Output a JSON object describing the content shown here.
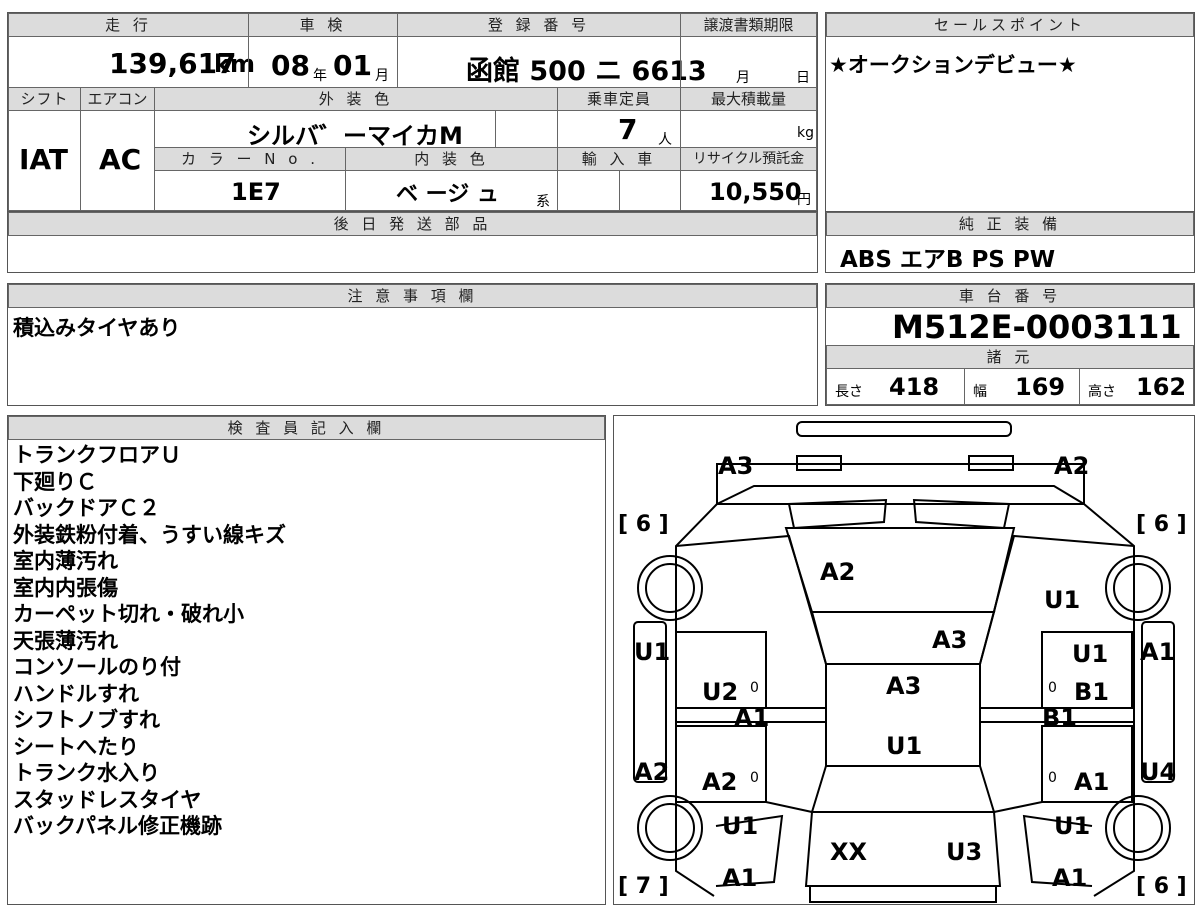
{
  "header": {
    "mileage_label": "走 行",
    "inspection_label": "車 検",
    "registration_label": "登 録 番 号",
    "transfer_label": "譲渡書類期限",
    "sales_label": "セールスポイント"
  },
  "vehicle": {
    "mileage_value": "139,617",
    "mileage_unit": "km",
    "inspection_year": "08",
    "inspection_year_unit": "年",
    "inspection_month": "01",
    "inspection_month_unit": "月",
    "registration_number": "函館 500 ニ 6613",
    "transfer_month_unit": "月",
    "transfer_day_unit": "日",
    "shift_label": "シフト",
    "shift_value": "IAT",
    "ac_label": "エアコン",
    "ac_value": "AC",
    "exterior_color_label": "外 装 色",
    "exterior_color_value": "シルバ゛ーマイカM",
    "color_no_label": "カ ラ ー N o .",
    "color_no_value": "1E7",
    "interior_color_label": "内 装 色",
    "interior_color_value": "ベ ージ ュ",
    "interior_color_suffix": "系",
    "capacity_label": "乗車定員",
    "capacity_value": "7",
    "capacity_unit": "人",
    "max_load_label": "最大積載量",
    "max_load_unit": "kg",
    "import_label": "輸 入 車",
    "recycle_label": "リサイクル預託金",
    "recycle_value": "10,550",
    "recycle_unit": "円"
  },
  "sales_point": "★オークションデビュー★",
  "later_parts_label": "後 日 発 送 部 品",
  "genuine_equipment": {
    "label": "純 正 装 備",
    "value": "ABS エアB PS PW"
  },
  "notes": {
    "label": "注 意 事 項 欄",
    "value": "積込みタイヤあり"
  },
  "chassis": {
    "label": "車 台 番 号",
    "value": "M512E-0003111",
    "specs_label": "諸 元",
    "length_label": "長さ",
    "length_value": "418",
    "width_label": "幅",
    "width_value": "169",
    "height_label": "高さ",
    "height_value": "162"
  },
  "inspector": {
    "label": "検 査 員 記 入 欄",
    "lines": [
      "トランクフロアＵ",
      "下廻りＣ",
      "バックドアＣ２",
      "外装鉄粉付着、うすい線キズ",
      "室内薄汚れ",
      "室内内張傷",
      "カーペット切れ・破れ小",
      "天張薄汚れ",
      "コンソールのり付",
      "ハンドルすれ",
      "シフトノブすれ",
      "シートへたり",
      "トランク水入り",
      "スタッドレスタイヤ",
      "バックパネル修正機跡"
    ]
  },
  "diagram": {
    "tread_top_left": "[ 6 ]",
    "tread_top_right": "[ 6 ]",
    "tread_bottom_left": "[ 7 ]",
    "tread_bottom_right": "[ 6 ]",
    "marks": {
      "rear_left": "A3",
      "rear_right": "A2",
      "rear_glass": "A2",
      "right_rear_fender": "U1",
      "roof_rear": "A3",
      "roof": "A3",
      "left_quarter": "U1",
      "right_quarter_upper": "U1",
      "right_quarter_outer": "A1",
      "left_rear_door": "U2",
      "left_rear_door_zero": "0",
      "right_rear_door": "B1",
      "right_rear_door_zero": "0",
      "left_step": "A1",
      "right_step": "B1",
      "roof_front": "U1",
      "left_front_outer": "A2",
      "left_front_door": "A2",
      "left_front_door_zero": "0",
      "right_front_door": "A1",
      "right_front_door_zero": "0",
      "right_front_outer": "U4",
      "left_fender": "U1",
      "right_fender": "U1",
      "hood_left": "XX",
      "hood_right": "U3",
      "front_left": "A1",
      "front_right": "A1"
    }
  }
}
